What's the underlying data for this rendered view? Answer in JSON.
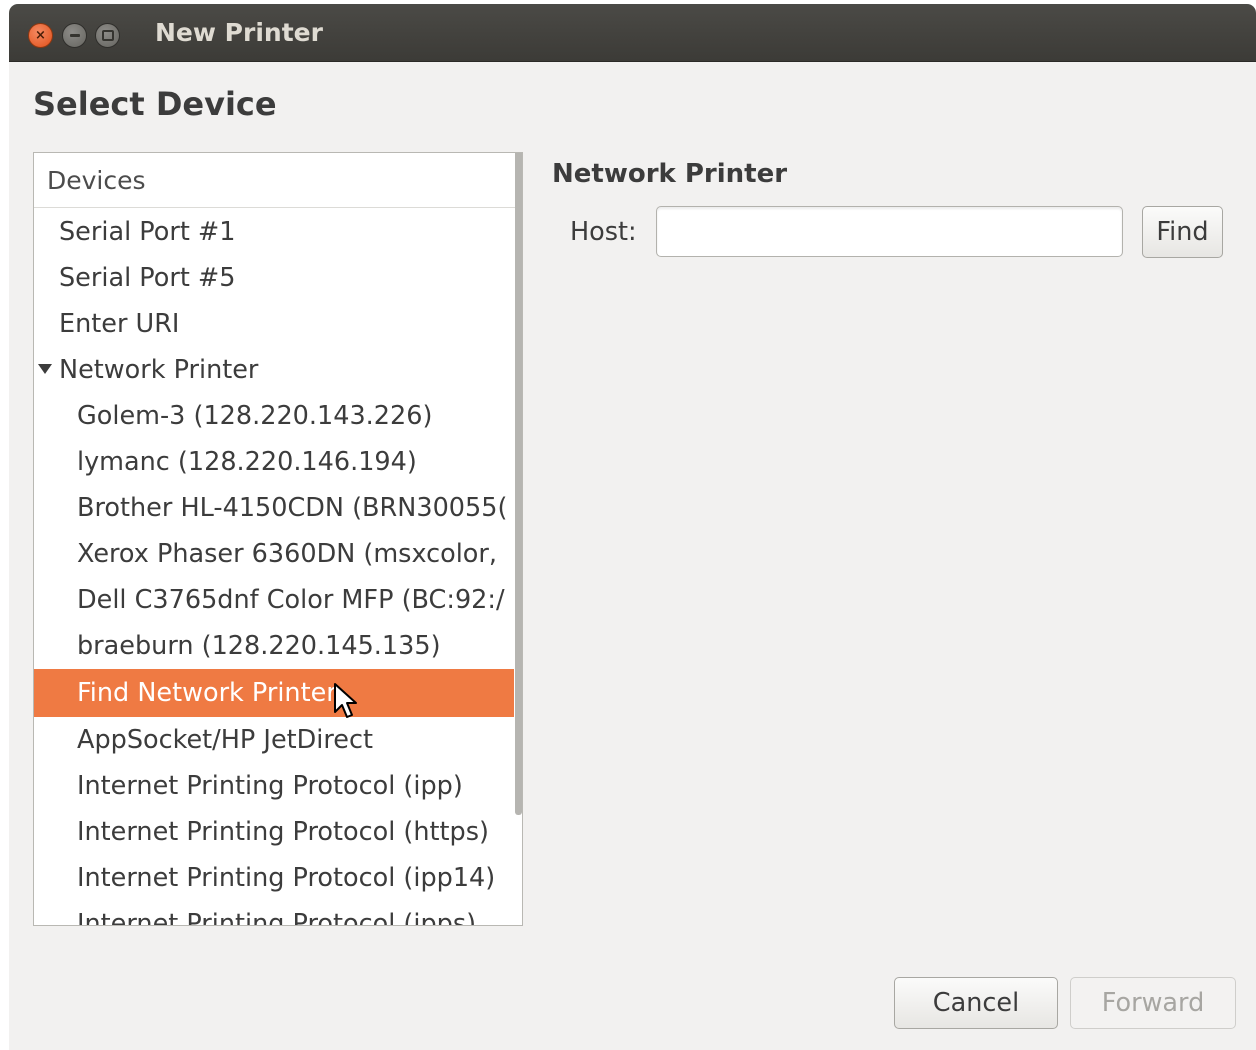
{
  "window": {
    "title": "New Printer",
    "controls": {
      "close_glyph": "×"
    }
  },
  "page": {
    "heading": "Select Device"
  },
  "devices": {
    "header": "Devices",
    "items": [
      {
        "label": "Serial Port #1",
        "level": 0
      },
      {
        "label": "Serial Port #5",
        "level": 0
      },
      {
        "label": "Enter URI",
        "level": 0
      },
      {
        "label": "Network Printer",
        "level": 0,
        "expanded": true
      },
      {
        "label": "Golem-3 (128.220.143.226)",
        "level": 1
      },
      {
        "label": "lymanc (128.220.146.194)",
        "level": 1
      },
      {
        "label": "Brother HL-4150CDN (BRN30055(",
        "level": 1
      },
      {
        "label": "Xerox Phaser 6360DN (msxcolor,",
        "level": 1
      },
      {
        "label": "Dell C3765dnf Color MFP (BC:92:/",
        "level": 1
      },
      {
        "label": "braeburn (128.220.145.135)",
        "level": 1
      },
      {
        "label": "Find Network Printer",
        "level": 1,
        "selected": true
      },
      {
        "label": "AppSocket/HP JetDirect",
        "level": 1
      },
      {
        "label": "Internet Printing Protocol (ipp)",
        "level": 1
      },
      {
        "label": "Internet Printing Protocol (https)",
        "level": 1
      },
      {
        "label": "Internet Printing Protocol (ipp14)",
        "level": 1
      },
      {
        "label": "Internet Printing Protocol (ipps)",
        "level": 1
      }
    ]
  },
  "network_printer": {
    "title": "Network Printer",
    "host_label": "Host:",
    "host_value": "",
    "find_label": "Find"
  },
  "footer": {
    "cancel_label": "Cancel",
    "forward_label": "Forward"
  },
  "colors": {
    "selection": "#ef7a43",
    "titlebar": "#3c3b37",
    "window_bg": "#f2f1f0"
  }
}
